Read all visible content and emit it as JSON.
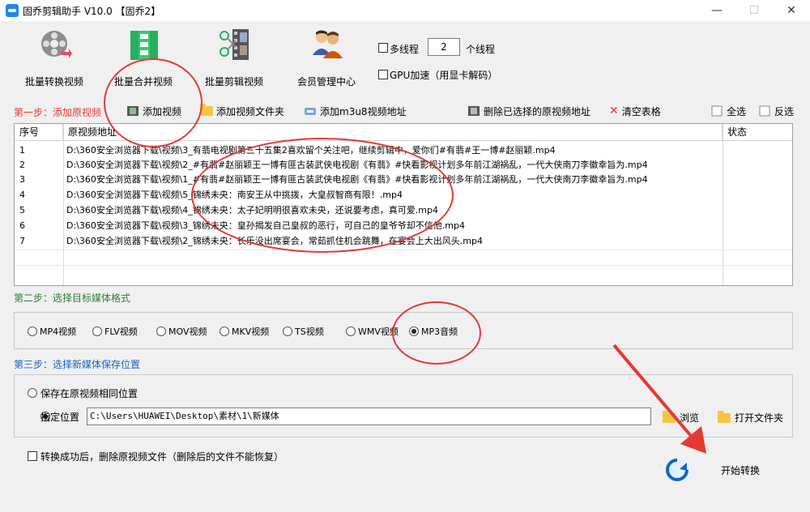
{
  "window": {
    "title": "固乔剪辑助手 V10.0 【固乔2】",
    "minimize_glyph": "—",
    "maximize_glyph": "☐",
    "close_glyph": "✕"
  },
  "toolbar": {
    "items": [
      {
        "label": "批量转换视频",
        "icon": "film-reel-icon"
      },
      {
        "label": "批量合并视频",
        "icon": "merge-video-icon"
      },
      {
        "label": "批量剪辑视频",
        "icon": "scissors-film-icon"
      },
      {
        "label": "会员管理中心",
        "icon": "users-icon"
      }
    ],
    "multithread_label": "多线程",
    "thread_count": "2",
    "thread_unit": "个线程",
    "gpu_label": "GPU加速（用显卡解码）"
  },
  "step1": {
    "label": "第一步：添加原视频",
    "add_video": "添加视频",
    "add_folder": "添加视频文件夹",
    "add_m3u8": "添加m3u8视频地址",
    "delete_selected": "删除已选择的原视频地址",
    "clear_table": "清空表格",
    "select_all": "全选",
    "invert_select": "反选"
  },
  "table": {
    "headers": [
      "序号",
      "原视频地址",
      "状态"
    ],
    "rows": [
      {
        "no": "1",
        "path": "D:\\360安全浏览器下载\\视频\\3_有翡电视剧第三十五集2喜欢留个关注吧，继续剪辑中，爱你们#有翡#王一博#赵丽颖.mp4"
      },
      {
        "no": "2",
        "path": "D:\\360安全浏览器下载\\视频\\2_#有翡#赵丽颖王一博有匪古装武侠电视剧《有翡》#快看影视计划多年前江湖祸乱，一代大侠南刀李徽幸旨为.mp4"
      },
      {
        "no": "3",
        "path": "D:\\360安全浏览器下载\\视频\\1_#有翡#赵丽颖王一博有匪古装武侠电视剧《有翡》#快看影视计划多年前江湖祸乱，一代大侠南刀李徽幸旨为.mp4"
      },
      {
        "no": "4",
        "path": "D:\\360安全浏览器下载\\视频\\5_锦绣未央：南安王从中挑拨，大皇叔智商有限！.mp4"
      },
      {
        "no": "5",
        "path": "D:\\360安全浏览器下载\\视频\\4_锦绣未央：太子妃明明很喜欢未央，还说要考虑，真可爱.mp4"
      },
      {
        "no": "6",
        "path": "D:\\360安全浏览器下载\\视频\\3_锦绣未央：皇孙揭发自己皇叔的恶行，可自己的皇爷爷却不信他.mp4"
      },
      {
        "no": "7",
        "path": "D:\\360安全浏览器下载\\视频\\2_锦绣未央：长乐没出席宴会，常茹抓住机会跳舞，在宴会上大出风头.mp4"
      }
    ]
  },
  "step2": {
    "label": "第二步：选择目标媒体格式",
    "formats": [
      "MP4视频",
      "FLV视频",
      "MOV视频",
      "MKV视频",
      "TS视频",
      "WMV视频",
      "MP3音频"
    ],
    "selected": 6
  },
  "step3": {
    "label": "第三步：选择新媒体保存位置",
    "same_location": "保存在原视频相同位置",
    "specify_location": "指定位置",
    "path": "C:\\Users\\HUAWEI\\Desktop\\素材\\1\\新媒体",
    "browse": "浏览",
    "open_folder": "打开文件夹"
  },
  "options": {
    "delete_after": "转换成功后，删除原视频文件（删除后的文件不能恢复）"
  },
  "start_button": "开始转换",
  "colors": {
    "accent_red": "#e53935",
    "step_blue": "#1565c0",
    "step_green": "#2e7d32"
  }
}
